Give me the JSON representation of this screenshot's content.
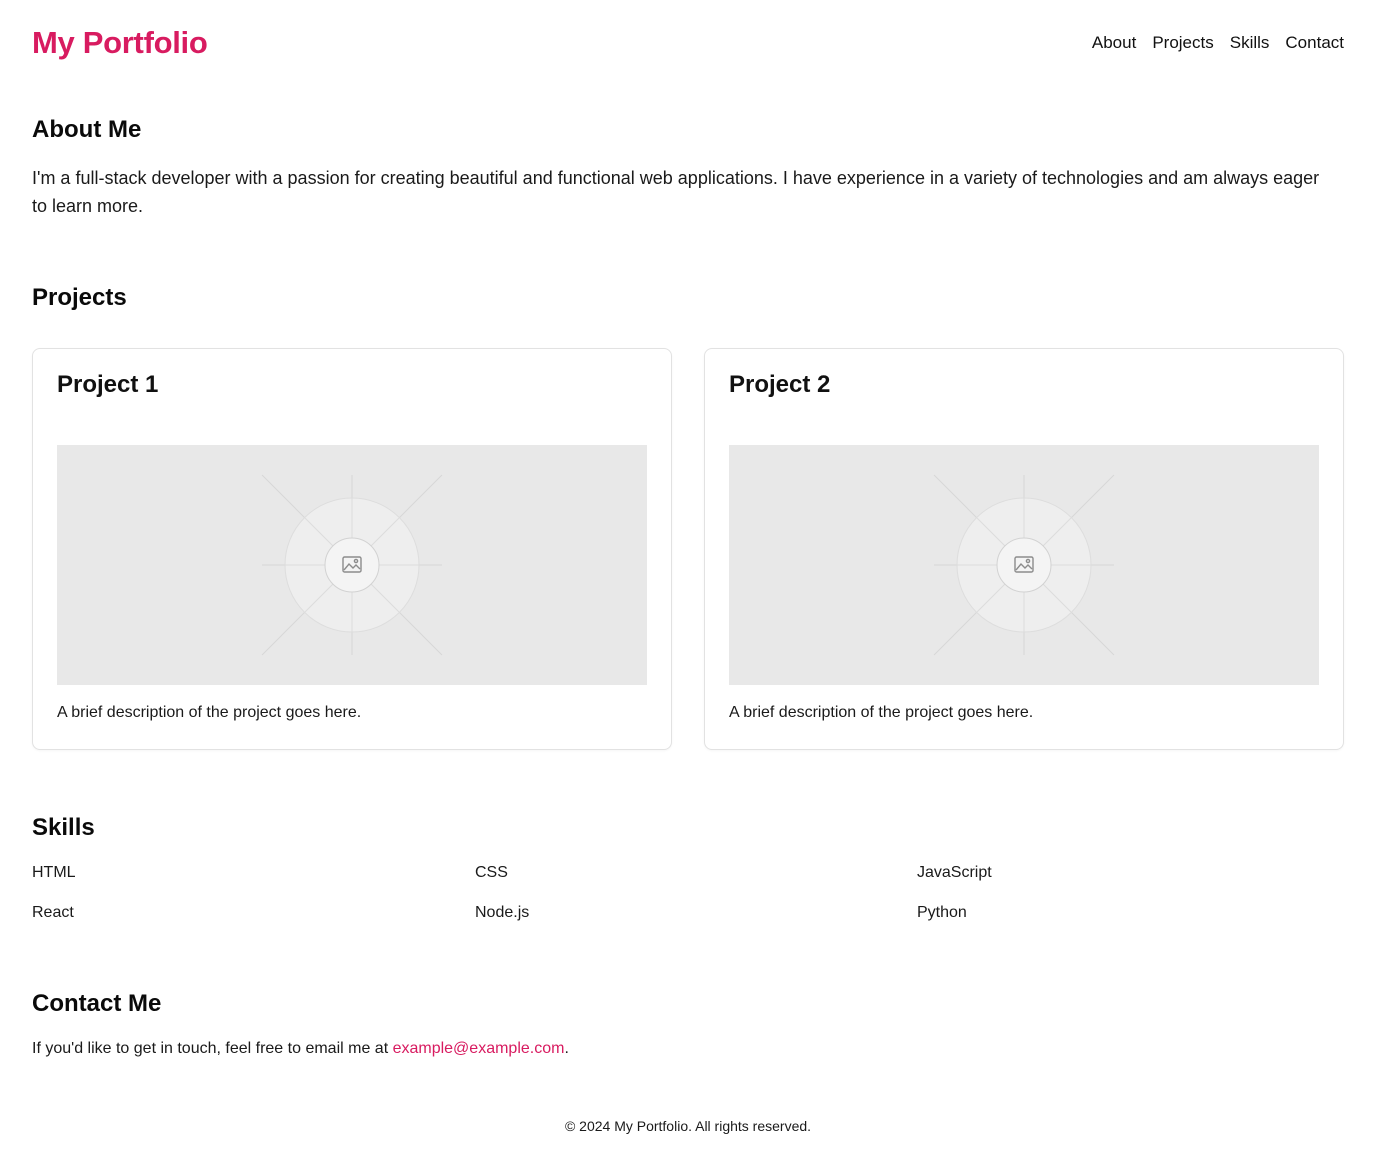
{
  "header": {
    "brand": "My Portfolio",
    "nav": [
      "About",
      "Projects",
      "Skills",
      "Contact"
    ]
  },
  "about": {
    "heading": "About Me",
    "text": "I'm a full-stack developer with a passion for creating beautiful and functional web applications. I have experience in a variety of technologies and am always eager to learn more."
  },
  "projects": {
    "heading": "Projects",
    "items": [
      {
        "title": "Project 1",
        "image_icon": "image-placeholder-icon",
        "description": "A brief description of the project goes here."
      },
      {
        "title": "Project 2",
        "image_icon": "image-placeholder-icon",
        "description": "A brief description of the project goes here."
      }
    ]
  },
  "skills": {
    "heading": "Skills",
    "items": [
      "HTML",
      "CSS",
      "JavaScript",
      "React",
      "Node.js",
      "Python"
    ]
  },
  "contact": {
    "heading": "Contact Me",
    "text_before": "If you'd like to get in touch, feel free to email me at ",
    "email": "example@example.com",
    "text_after": "."
  },
  "footer": {
    "text": "© 2024 My Portfolio. All rights reserved."
  },
  "colors": {
    "accent": "#d81b60",
    "text": "#111111",
    "placeholder_bg": "#e8e8e8",
    "card_border": "#e2e2e2"
  }
}
